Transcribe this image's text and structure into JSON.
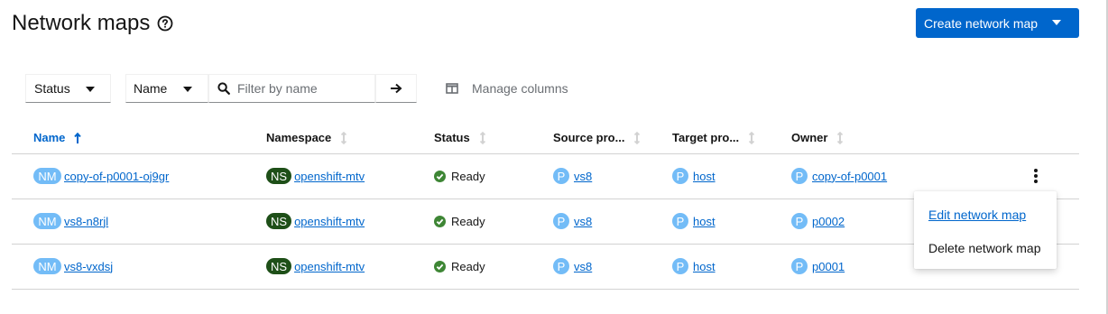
{
  "header": {
    "title": "Network maps",
    "create_button": "Create network map"
  },
  "toolbar": {
    "status_filter": "Status",
    "name_filter": "Name",
    "search_placeholder": "Filter by name",
    "manage_columns": "Manage columns"
  },
  "table": {
    "columns": [
      "Name",
      "Namespace",
      "Status",
      "Source pro...",
      "Target pro...",
      "Owner"
    ],
    "rows": [
      {
        "name_badge": "NM",
        "name": "copy-of-p0001-oj9gr",
        "ns_badge": "NS",
        "namespace": "openshift-mtv",
        "status": "Ready",
        "p_badge": "P",
        "source": "vs8",
        "target": "host",
        "owner": "copy-of-p0001"
      },
      {
        "name_badge": "NM",
        "name": "vs8-n8rjl",
        "ns_badge": "NS",
        "namespace": "openshift-mtv",
        "status": "Ready",
        "p_badge": "P",
        "source": "vs8",
        "target": "host",
        "owner": "p0002"
      },
      {
        "name_badge": "NM",
        "name": "vs8-vxdsj",
        "ns_badge": "NS",
        "namespace": "openshift-mtv",
        "status": "Ready",
        "p_badge": "P",
        "source": "vs8",
        "target": "host",
        "owner": "p0001"
      }
    ]
  },
  "row_menu": {
    "edit": "Edit network map",
    "delete": "Delete network map"
  },
  "colors": {
    "accent": "#0066cc",
    "ready": "#3e8635",
    "ns_badge": "#1e4f18",
    "p_badge": "#73bcf7"
  }
}
